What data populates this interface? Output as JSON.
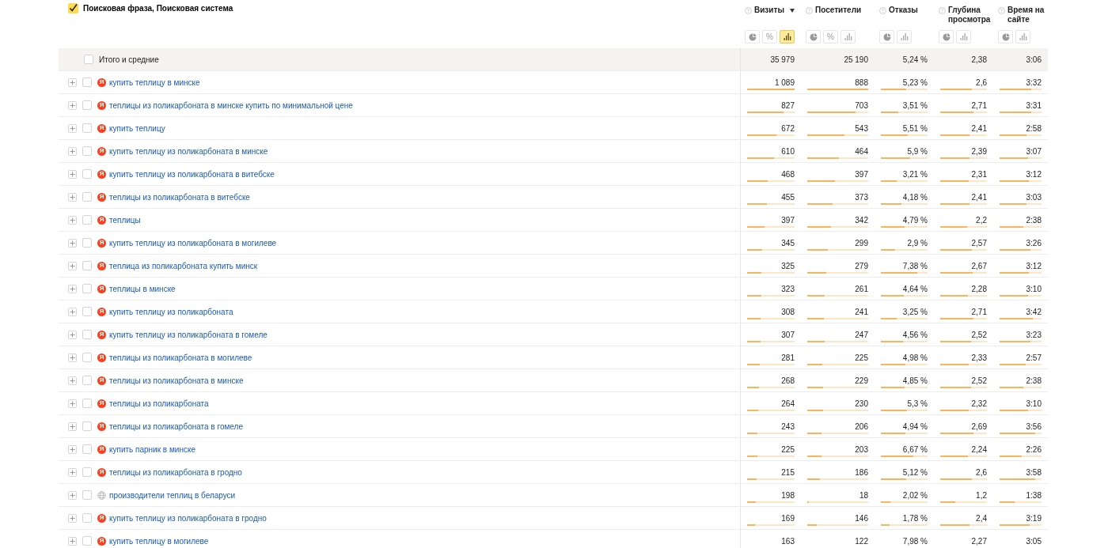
{
  "header": {
    "checked": true,
    "title": "Поисковая фраза, Поисковая система"
  },
  "columns": [
    {
      "label": "Визиты",
      "sorted": true,
      "buttons": [
        {
          "kind": "pie",
          "selected": false
        },
        {
          "kind": "percent",
          "label": "%",
          "selected": false
        },
        {
          "kind": "bars",
          "selected": true
        }
      ]
    },
    {
      "label": "Посетители",
      "sorted": false,
      "buttons": [
        {
          "kind": "pie",
          "selected": false
        },
        {
          "kind": "percent",
          "label": "%",
          "selected": false
        },
        {
          "kind": "bars",
          "selected": false
        }
      ]
    },
    {
      "label": "Отказы",
      "sorted": false,
      "buttons": [
        {
          "kind": "pie",
          "selected": false
        },
        {
          "kind": "bars",
          "selected": false
        }
      ]
    },
    {
      "label": "Глубина просмотра",
      "sorted": false,
      "buttons": [
        {
          "kind": "pie",
          "selected": false
        },
        {
          "kind": "bars",
          "selected": false
        }
      ]
    },
    {
      "label": "Время на сайте",
      "sorted": false,
      "buttons": [
        {
          "kind": "pie",
          "selected": false
        },
        {
          "kind": "bars",
          "selected": false
        }
      ]
    }
  ],
  "total": {
    "label": "Итого и средние",
    "checked": false,
    "values": [
      "35 979",
      "25 190",
      "5,24 %",
      "2,38",
      "3:06"
    ]
  },
  "rows": [
    {
      "phrase": "купить теплицу в минске",
      "kind": "yandex",
      "badge": "Я",
      "checked": false,
      "cells": [
        {
          "value": "1 089",
          "level": 1.0
        },
        {
          "value": "888",
          "level": 1.0
        },
        {
          "value": "5,23 %",
          "level": 0.55
        },
        {
          "value": "2,6",
          "level": 0.68
        },
        {
          "value": "3:32",
          "level": 0.76
        }
      ]
    },
    {
      "phrase": "теплицы из поликарбоната в минске купить по минимальной цене",
      "kind": "yandex",
      "badge": "Я",
      "checked": false,
      "cells": [
        {
          "value": "827",
          "level": 0.76
        },
        {
          "value": "703",
          "level": 0.79
        },
        {
          "value": "3,51 %",
          "level": 0.37
        },
        {
          "value": "2,71",
          "level": 0.71
        },
        {
          "value": "3:31",
          "level": 0.75
        }
      ]
    },
    {
      "phrase": "купить теплицу",
      "kind": "yandex",
      "badge": "Я",
      "checked": false,
      "cells": [
        {
          "value": "672",
          "level": 0.62
        },
        {
          "value": "543",
          "level": 0.61
        },
        {
          "value": "5,51 %",
          "level": 0.58
        },
        {
          "value": "2,41",
          "level": 0.63
        },
        {
          "value": "2:58",
          "level": 0.64
        }
      ]
    },
    {
      "phrase": "купить теплицу из поликарбоната в минске",
      "kind": "yandex",
      "badge": "Я",
      "checked": false,
      "cells": [
        {
          "value": "610",
          "level": 0.56
        },
        {
          "value": "464",
          "level": 0.52
        },
        {
          "value": "5,9 %",
          "level": 0.62
        },
        {
          "value": "2,39",
          "level": 0.63
        },
        {
          "value": "3:07",
          "level": 0.67
        }
      ]
    },
    {
      "phrase": "купить теплицу из поликарбоната в витебске",
      "kind": "yandex",
      "badge": "Я",
      "checked": false,
      "cells": [
        {
          "value": "468",
          "level": 0.43
        },
        {
          "value": "397",
          "level": 0.45
        },
        {
          "value": "3,21 %",
          "level": 0.34
        },
        {
          "value": "2,31",
          "level": 0.61
        },
        {
          "value": "3:12",
          "level": 0.69
        }
      ]
    },
    {
      "phrase": "теплицы из поликарбоната в витебске",
      "kind": "yandex",
      "badge": "Я",
      "checked": false,
      "cells": [
        {
          "value": "455",
          "level": 0.42
        },
        {
          "value": "373",
          "level": 0.42
        },
        {
          "value": "4,18 %",
          "level": 0.44
        },
        {
          "value": "2,41",
          "level": 0.63
        },
        {
          "value": "3:03",
          "level": 0.65
        }
      ]
    },
    {
      "phrase": "теплицы",
      "kind": "yandex",
      "badge": "Я",
      "checked": false,
      "cells": [
        {
          "value": "397",
          "level": 0.36
        },
        {
          "value": "342",
          "level": 0.39
        },
        {
          "value": "4,79 %",
          "level": 0.5
        },
        {
          "value": "2,2",
          "level": 0.58
        },
        {
          "value": "2:38",
          "level": 0.56
        }
      ]
    },
    {
      "phrase": "купить теплицу из поликарбоната в могилеве",
      "kind": "yandex",
      "badge": "Я",
      "checked": false,
      "cells": [
        {
          "value": "345",
          "level": 0.32
        },
        {
          "value": "299",
          "level": 0.34
        },
        {
          "value": "2,9 %",
          "level": 0.31
        },
        {
          "value": "2,57",
          "level": 0.68
        },
        {
          "value": "3:26",
          "level": 0.74
        }
      ]
    },
    {
      "phrase": "теплица из поликарбоната купить минск",
      "kind": "yandex",
      "badge": "Я",
      "checked": false,
      "cells": [
        {
          "value": "325",
          "level": 0.3
        },
        {
          "value": "279",
          "level": 0.31
        },
        {
          "value": "7,38 %",
          "level": 0.78
        },
        {
          "value": "2,67",
          "level": 0.7
        },
        {
          "value": "3:12",
          "level": 0.69
        }
      ]
    },
    {
      "phrase": "теплицы в минске",
      "kind": "yandex",
      "badge": "Я",
      "checked": false,
      "cells": [
        {
          "value": "323",
          "level": 0.3
        },
        {
          "value": "261",
          "level": 0.29
        },
        {
          "value": "4,64 %",
          "level": 0.49
        },
        {
          "value": "2,28",
          "level": 0.6
        },
        {
          "value": "3:10",
          "level": 0.68
        }
      ]
    },
    {
      "phrase": "купить теплицу из поликарбоната",
      "kind": "yandex",
      "badge": "Я",
      "checked": false,
      "cells": [
        {
          "value": "308",
          "level": 0.28
        },
        {
          "value": "241",
          "level": 0.27
        },
        {
          "value": "3,25 %",
          "level": 0.34
        },
        {
          "value": "2,71",
          "level": 0.71
        },
        {
          "value": "3:42",
          "level": 0.79
        }
      ]
    },
    {
      "phrase": "купить теплицу из поликарбоната в гомеле",
      "kind": "yandex",
      "badge": "Я",
      "checked": false,
      "cells": [
        {
          "value": "307",
          "level": 0.28
        },
        {
          "value": "247",
          "level": 0.28
        },
        {
          "value": "4,56 %",
          "level": 0.48
        },
        {
          "value": "2,52",
          "level": 0.66
        },
        {
          "value": "3:23",
          "level": 0.73
        }
      ]
    },
    {
      "phrase": "теплицы из поликарбоната в могилеве",
      "kind": "yandex",
      "badge": "Я",
      "checked": false,
      "cells": [
        {
          "value": "281",
          "level": 0.26
        },
        {
          "value": "225",
          "level": 0.25
        },
        {
          "value": "4,98 %",
          "level": 0.52
        },
        {
          "value": "2,33",
          "level": 0.61
        },
        {
          "value": "2:57",
          "level": 0.63
        }
      ]
    },
    {
      "phrase": "теплицы из поликарбоната в минске",
      "kind": "yandex",
      "badge": "Я",
      "checked": false,
      "cells": [
        {
          "value": "268",
          "level": 0.25
        },
        {
          "value": "229",
          "level": 0.26
        },
        {
          "value": "4,85 %",
          "level": 0.51
        },
        {
          "value": "2,52",
          "level": 0.66
        },
        {
          "value": "2:38",
          "level": 0.56
        }
      ]
    },
    {
      "phrase": "теплицы из поликарбоната",
      "kind": "yandex",
      "badge": "Я",
      "checked": false,
      "cells": [
        {
          "value": "264",
          "level": 0.24
        },
        {
          "value": "230",
          "level": 0.26
        },
        {
          "value": "5,3 %",
          "level": 0.56
        },
        {
          "value": "2,32",
          "level": 0.61
        },
        {
          "value": "3:10",
          "level": 0.68
        }
      ]
    },
    {
      "phrase": "теплицы из поликарбоната в гомеле",
      "kind": "yandex",
      "badge": "Я",
      "checked": false,
      "cells": [
        {
          "value": "243",
          "level": 0.22
        },
        {
          "value": "206",
          "level": 0.23
        },
        {
          "value": "4,94 %",
          "level": 0.52
        },
        {
          "value": "2,69",
          "level": 0.71
        },
        {
          "value": "3:56",
          "level": 0.84
        }
      ]
    },
    {
      "phrase": "купить парник в минске",
      "kind": "yandex",
      "badge": "Я",
      "checked": false,
      "cells": [
        {
          "value": "225",
          "level": 0.21
        },
        {
          "value": "203",
          "level": 0.23
        },
        {
          "value": "6,67 %",
          "level": 0.7
        },
        {
          "value": "2,24",
          "level": 0.59
        },
        {
          "value": "2:26",
          "level": 0.52
        }
      ]
    },
    {
      "phrase": "теплицы из поликарбоната в гродно",
      "kind": "yandex",
      "badge": "Я",
      "checked": false,
      "cells": [
        {
          "value": "215",
          "level": 0.2
        },
        {
          "value": "186",
          "level": 0.21
        },
        {
          "value": "5,12 %",
          "level": 0.54
        },
        {
          "value": "2,6",
          "level": 0.68
        },
        {
          "value": "3:58",
          "level": 0.85
        }
      ]
    },
    {
      "phrase": "производители теплиц в беларуси",
      "kind": "other",
      "checked": false,
      "cells": [
        {
          "value": "198",
          "level": 0.18
        },
        {
          "value": "18",
          "level": 0.02
        },
        {
          "value": "2,02 %",
          "level": 0.21
        },
        {
          "value": "1,2",
          "level": 0.32
        },
        {
          "value": "1:38",
          "level": 0.35
        }
      ]
    },
    {
      "phrase": "купить теплицу из поликарбоната в гродно",
      "kind": "yandex",
      "badge": "Я",
      "checked": false,
      "cells": [
        {
          "value": "169",
          "level": 0.16
        },
        {
          "value": "146",
          "level": 0.16
        },
        {
          "value": "1,78 %",
          "level": 0.19
        },
        {
          "value": "2,4",
          "level": 0.63
        },
        {
          "value": "3:19",
          "level": 0.71
        }
      ]
    },
    {
      "phrase": "купить теплицу в могилеве",
      "kind": "yandex",
      "badge": "Я",
      "checked": false,
      "cells": [
        {
          "value": "163"
        },
        {
          "value": "122"
        },
        {
          "value": "7,98 %"
        },
        {
          "value": "2,27"
        },
        {
          "value": "3:05"
        }
      ]
    }
  ]
}
